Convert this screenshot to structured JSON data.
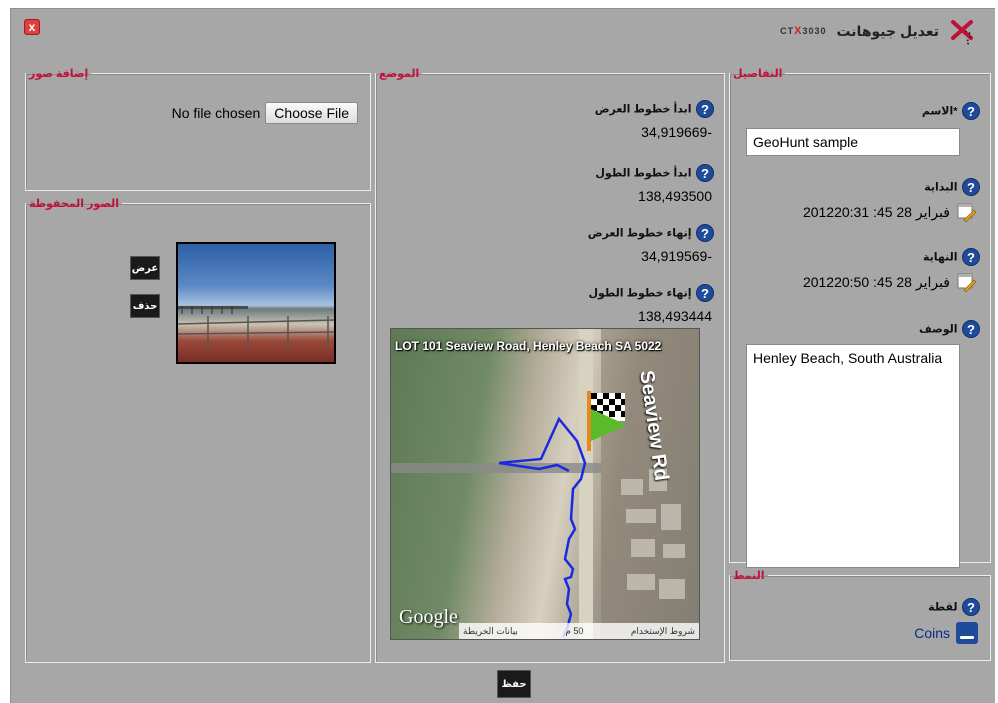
{
  "window": {
    "title": "تعديل جيوهانت",
    "brand_prefix": "CT",
    "brand_x": "X",
    "brand_suffix": "3030",
    "close_glyph": "x"
  },
  "help_glyph": "?",
  "details": {
    "legend": "التفاصيل",
    "name_label": "*الاسم",
    "name_value": "GeoHunt sample",
    "start_label": "البداية",
    "start_value": "201220:31 :45 فبراير 28",
    "end_label": "النهاية",
    "end_value": "201220:50 :45 فبراير 28",
    "description_label": "الوصف",
    "description_value": "Henley Beach, South Australia"
  },
  "position": {
    "legend": "الموضع",
    "start_lat_label": "ابدأ خطوط العرض",
    "start_lat_value": "34,919669-",
    "start_lon_label": "ابدأ خطوط الطول",
    "start_lon_value": "138,493500",
    "end_lat_label": "إنهاء خطوط العرض",
    "end_lat_value": "34,919569-",
    "end_lon_label": "إنهاء خطوط الطول",
    "end_lon_value": "138,493444"
  },
  "map": {
    "address": "LOT 101 Seaview Road, Henley Beach SA 5022",
    "street_label": "Seaview Rd",
    "google_logo": "Google",
    "terms": "شروط الإستخدام",
    "scale": "50 م",
    "map_data": "بيانات الخريطة"
  },
  "add_photos": {
    "legend": "إضافة صور",
    "choose_label": "Choose File",
    "no_file": "No file chosen"
  },
  "saved_photos": {
    "legend": "الصور المحفوظة",
    "view_label": "عرض",
    "delete_label": "حذف"
  },
  "type": {
    "legend": "النمط",
    "point_label": "لقطة",
    "option": "Coins"
  },
  "save_label": "حفظ",
  "colors": {
    "accent": "#c0103a",
    "help": "#1f4b9a",
    "panel_bg": "#a7a7a7"
  }
}
